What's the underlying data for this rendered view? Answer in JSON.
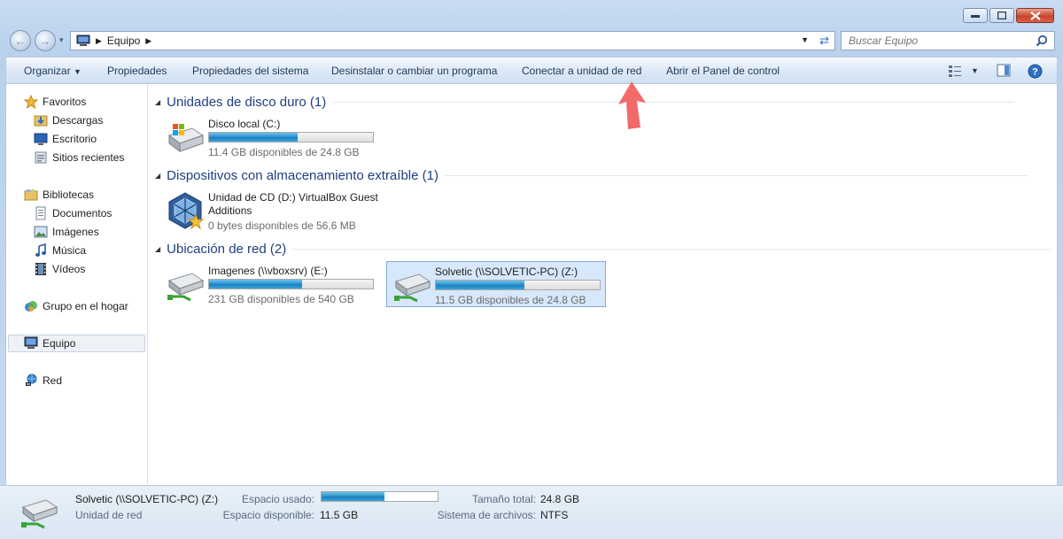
{
  "address": {
    "crumbs": [
      "Equipo"
    ]
  },
  "search": {
    "placeholder": "Buscar Equipo"
  },
  "toolbar": {
    "organize": "Organizar",
    "properties": "Propiedades",
    "system_properties": "Propiedades del sistema",
    "uninstall": "Desinstalar o cambiar un programa",
    "map_drive": "Conectar a unidad de red",
    "control_panel": "Abrir el Panel de control"
  },
  "sidebar": {
    "favorites": "Favoritos",
    "downloads": "Descargas",
    "desktop": "Escritorio",
    "recent": "Sitios recientes",
    "libraries": "Bibliotecas",
    "documents": "Documentos",
    "images": "Imágenes",
    "music": "Música",
    "videos": "Vídeos",
    "homegroup": "Grupo en el hogar",
    "computer": "Equipo",
    "network": "Red"
  },
  "groups": {
    "hdd": {
      "title": "Unidades de disco duro (1)",
      "drives": [
        {
          "name": "Disco local (C:)",
          "free": "11.4 GB disponibles de 24.8 GB",
          "used_fraction": 0.54
        }
      ]
    },
    "removable": {
      "title": "Dispositivos con almacenamiento extraíble (1)",
      "drives": [
        {
          "name_line1": "Unidad de CD (D:) VirtualBox Guest",
          "name_line2": "Additions",
          "free": "0 bytes disponibles de 56.6 MB"
        }
      ]
    },
    "network": {
      "title": "Ubicación de red (2)",
      "drives": [
        {
          "name": "Imagenes (\\\\vboxsrv) (E:)",
          "free": "231 GB disponibles de 540 GB",
          "used_fraction": 0.57
        },
        {
          "name": "Solvetic (\\\\SOLVETIC-PC) (Z:)",
          "free": "11.5 GB disponibles de 24.8 GB",
          "used_fraction": 0.54
        }
      ]
    }
  },
  "details": {
    "name": "Solvetic (\\\\SOLVETIC-PC) (Z:)",
    "type": "Unidad de red",
    "used_label": "Espacio usado:",
    "used_fraction": 0.54,
    "free_label": "Espacio disponible:",
    "free_value": "11.5 GB",
    "total_label": "Tamaño total:",
    "total_value": "24.8 GB",
    "fs_label": "Sistema de archivos:",
    "fs_value": "NTFS"
  },
  "colors": {
    "accent": "#1e3f80",
    "bar_fill": "#2c93cf",
    "arrow": "#f26a6a"
  }
}
